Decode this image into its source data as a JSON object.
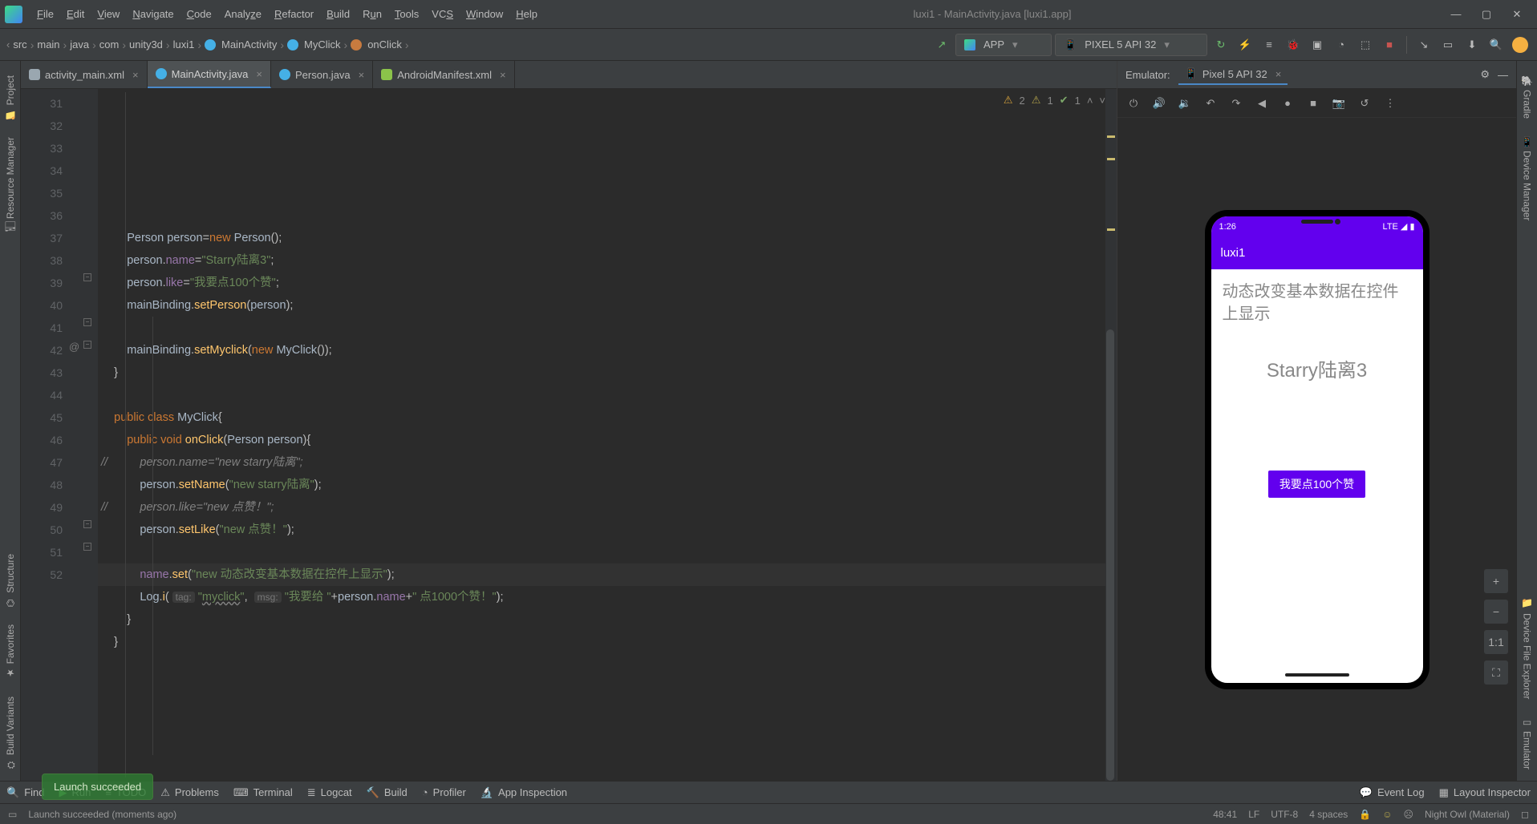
{
  "window_title": "luxi1 - MainActivity.java [luxi1.app]",
  "menu": [
    "File",
    "Edit",
    "View",
    "Navigate",
    "Code",
    "Analyze",
    "Refactor",
    "Build",
    "Run",
    "Tools",
    "VCS",
    "Window",
    "Help"
  ],
  "breadcrumb": {
    "items": [
      "src",
      "main",
      "java",
      "com",
      "unity3d",
      "luxi1",
      "MainActivity",
      "MyClick",
      "onClick"
    ],
    "class_icon_indices": [
      6,
      7,
      8
    ]
  },
  "run_config": {
    "name": "APP"
  },
  "device_config": {
    "name": "PIXEL 5 API 32"
  },
  "tabs": [
    {
      "label": "activity_main.xml",
      "active": false,
      "icon_color": "#9aa7b0"
    },
    {
      "label": "MainActivity.java",
      "active": true,
      "icon_color": "#45b0e6"
    },
    {
      "label": "Person.java",
      "active": false,
      "icon_color": "#45b0e6"
    },
    {
      "label": "AndroidManifest.xml",
      "active": false,
      "icon_color": "#8bc34a"
    }
  ],
  "inspections": {
    "warn_yellow": "2",
    "warn_weak": "1",
    "typo": "1"
  },
  "code_lines": [
    {
      "n": 31,
      "html": ""
    },
    {
      "n": 32,
      "html": ""
    },
    {
      "n": 33,
      "html": "        <span class='cls'>Person</span> <span class='id'>person</span>=<span class='kw'>new</span> <span class='cls'>Person</span>();"
    },
    {
      "n": 34,
      "html": "        <span class='id'>person</span>.<span class='field'>name</span>=<span class='str'>\"Starry陆离3\"</span>;"
    },
    {
      "n": 35,
      "html": "        <span class='id'>person</span>.<span class='field'>like</span>=<span class='str'>\"我要点100个赞\"</span>;"
    },
    {
      "n": 36,
      "html": "        <span class='id'>mainBinding</span>.<span class='call'>setPerson</span>(<span class='id'>person</span>);"
    },
    {
      "n": 37,
      "html": ""
    },
    {
      "n": 38,
      "html": "        <span class='id'>mainBinding</span>.<span class='call'>setMyclick</span>(<span class='kw'>new</span> <span class='cls'>MyClick</span>());"
    },
    {
      "n": 39,
      "html": "    }"
    },
    {
      "n": 40,
      "html": ""
    },
    {
      "n": 41,
      "html": "    <span class='kw'>public</span> <span class='kw'>class</span> <span class='cls'>MyClick</span>{"
    },
    {
      "n": 42,
      "html": "        <span class='kw'>public</span> <span class='kw'>void</span> <span class='call'>onClick</span>(<span class='cls'>Person</span> <span class='id'>person</span>){"
    },
    {
      "n": 43,
      "html": "<span class='com'>//          person.name=\"new starry陆离\";</span>"
    },
    {
      "n": 44,
      "html": "            <span class='id'>person</span>.<span class='call'>setName</span>(<span class='str'>\"new starry陆离\"</span>);"
    },
    {
      "n": 45,
      "html": "<span class='com'>//          person.like=\"new 点赞！\";</span>"
    },
    {
      "n": 46,
      "html": "            <span class='id'>person</span>.<span class='call'>setLike</span>(<span class='str'>\"new 点赞！\"</span>);"
    },
    {
      "n": 47,
      "html": ""
    },
    {
      "n": 48,
      "html": "            <span class='field'>name</span>.<span class='call'>set</span>(<span class='str'>\"new 动态改变基本数据在控件上显示\"</span>);",
      "current": true
    },
    {
      "n": 49,
      "html": "            <span class='cls'>Log</span>.<span class='call'>i</span>( <span class='hint'>tag:</span> <span class='str'>\"<span class='underwave'>myclick</span>\"</span>,  <span class='hint'>msg:</span> <span class='str'>\"我要给 \"</span>+<span class='id'>person</span>.<span class='field'>name</span>+<span class='str'>\" 点1000个赞！\"</span>);"
    },
    {
      "n": 50,
      "html": "        }"
    },
    {
      "n": 51,
      "html": "    }"
    },
    {
      "n": 52,
      "html": ""
    }
  ],
  "left_tools": [
    "Project",
    "Resource Manager",
    "Structure",
    "Favorites",
    "Build Variants"
  ],
  "right_tools": [
    "Gradle",
    "Device Manager",
    "Device File Explorer",
    "Emulator"
  ],
  "emulator": {
    "header_label": "Emulator:",
    "device_tab": "Pixel 5 API 32",
    "statusbar_time": "1:26",
    "statusbar_right": "LTE ◢ ▮",
    "app_title": "luxi1",
    "text_line1": "动态改变基本数据在控件上显示",
    "text_line2": "Starry陆离3",
    "button_label": "我要点100个赞",
    "zoom_buttons": [
      "+",
      "−",
      "1:1",
      "⛶"
    ]
  },
  "bottom_tools": [
    "Find",
    "Run",
    "TODO",
    "Problems",
    "Terminal",
    "Logcat",
    "Build",
    "Profiler",
    "App Inspection"
  ],
  "bottom_right": [
    "Event Log",
    "Layout Inspector"
  ],
  "toast": "Launch succeeded",
  "status": {
    "msg": "Launch succeeded (moments ago)",
    "caret": "48:41",
    "lineend": "LF",
    "encoding": "UTF-8",
    "indent": "4 spaces",
    "theme": "Night Owl (Material)"
  }
}
